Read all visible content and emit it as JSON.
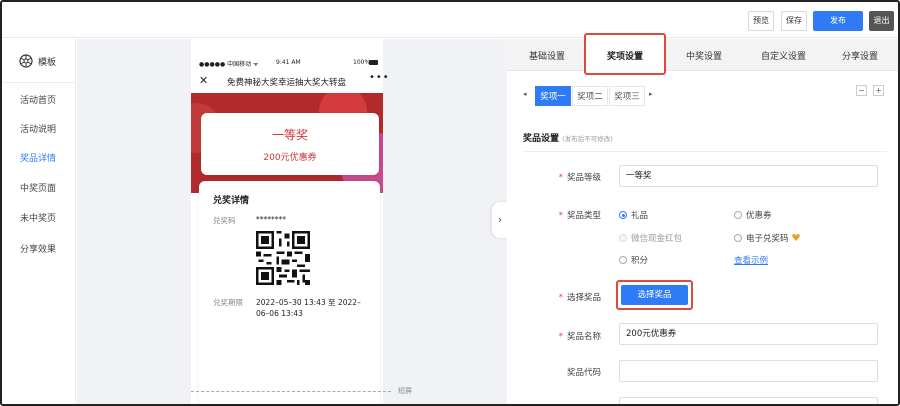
{
  "toolbar": {
    "preview_label": "预览",
    "save_label": "保存",
    "publish_label": "发布",
    "exit_label": "退出"
  },
  "sidebar": {
    "header": "模板",
    "items": [
      {
        "label": "活动首页"
      },
      {
        "label": "活动说明"
      },
      {
        "label": "奖品详情",
        "active": true
      },
      {
        "label": "中奖页面"
      },
      {
        "label": "未中奖页"
      },
      {
        "label": "分享效果"
      }
    ]
  },
  "phone": {
    "carrier": "●●●●● 中国移动 ᯤ",
    "time": "9:41 AM",
    "battery": "100%",
    "close": "✕",
    "title": "免费神秘大奖幸运抽大奖大转盘",
    "more": "•••",
    "prize_name": "一等奖",
    "prize_sub": "200元优惠券",
    "redeem_title": "兑奖详情",
    "code_label": "兑奖码",
    "code_value": "********",
    "period_label": "兑奖期限",
    "period_value": "2022–05–30 13:43 至 2022–06–06 13:43"
  },
  "canvas": {
    "fold_label": "短屏",
    "collapse_arrow": "›"
  },
  "panel": {
    "tabs": [
      {
        "label": "基础设置"
      },
      {
        "label": "奖项设置",
        "active": true
      },
      {
        "label": "中奖设置"
      },
      {
        "label": "自定义设置"
      },
      {
        "label": "分享设置"
      }
    ],
    "subtabs": [
      {
        "label": "奖项一",
        "active": true
      },
      {
        "label": "奖项二"
      },
      {
        "label": "奖项三"
      }
    ],
    "subtab_prev": "◂",
    "subtab_next": "▸",
    "minus": "−",
    "plus": "+",
    "section_title": "奖品设置",
    "section_note": "(发布后不可修改)",
    "fields": {
      "level_label": "奖品等级",
      "level_value": "一等奖",
      "type_label": "奖品类型",
      "type_options": [
        {
          "label": "礼品",
          "checked": true
        },
        {
          "label": "优惠券"
        },
        {
          "label": "微信现金红包",
          "disabled": true
        },
        {
          "label": "电子兑奖码"
        },
        {
          "label": "积分"
        }
      ],
      "example_link": "查看示例",
      "choose_label": "选择奖品",
      "choose_button": "选择奖品",
      "name_label": "奖品名称",
      "name_value": "200元优惠券",
      "code_label": "奖品代码",
      "code_value": ""
    }
  },
  "colors": {
    "accent": "#2f7bf5",
    "highlight": "#e0483c",
    "banner": "#b32a2d",
    "prize_text": "#d0353a"
  }
}
